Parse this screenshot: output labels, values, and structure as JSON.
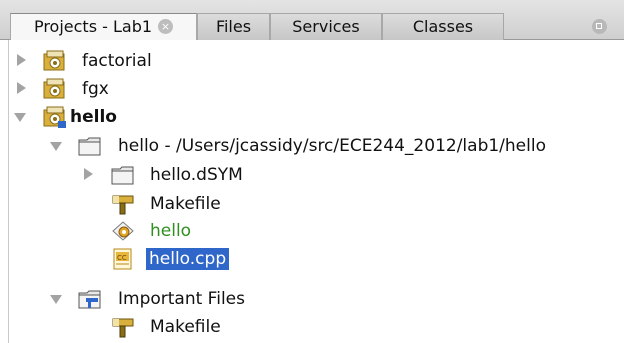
{
  "tabs": [
    {
      "label": "Projects - Lab1",
      "active": true
    },
    {
      "label": "Files"
    },
    {
      "label": "Services"
    },
    {
      "label": "Classes"
    }
  ],
  "tree": [
    {
      "label": "factorial",
      "icon": "project-icon",
      "expander": "collapsed"
    },
    {
      "label": "fgx",
      "icon": "project-icon",
      "expander": "collapsed"
    },
    {
      "label": "hello",
      "icon": "main-project-icon",
      "expander": "expanded",
      "bold": true
    },
    {
      "label": "hello - /Users/jcassidy/src/ECE244_2012/lab1/hello",
      "icon": "folder-icon",
      "expander": "expanded"
    },
    {
      "label": "hello.dSYM",
      "icon": "folder-icon",
      "expander": "collapsed"
    },
    {
      "label": "Makefile",
      "icon": "makefile-icon"
    },
    {
      "label": "hello",
      "icon": "executable-icon",
      "color": "#2f8f1f"
    },
    {
      "label": "hello.cpp",
      "icon": "cpp-file-icon",
      "selected": true
    },
    {
      "label": "Important Files",
      "icon": "important-files-icon",
      "expander": "expanded"
    },
    {
      "label": "Makefile",
      "icon": "makefile-icon"
    }
  ],
  "colors": {
    "selection": "#2f66c9",
    "executable_text": "#2f8f1f"
  }
}
